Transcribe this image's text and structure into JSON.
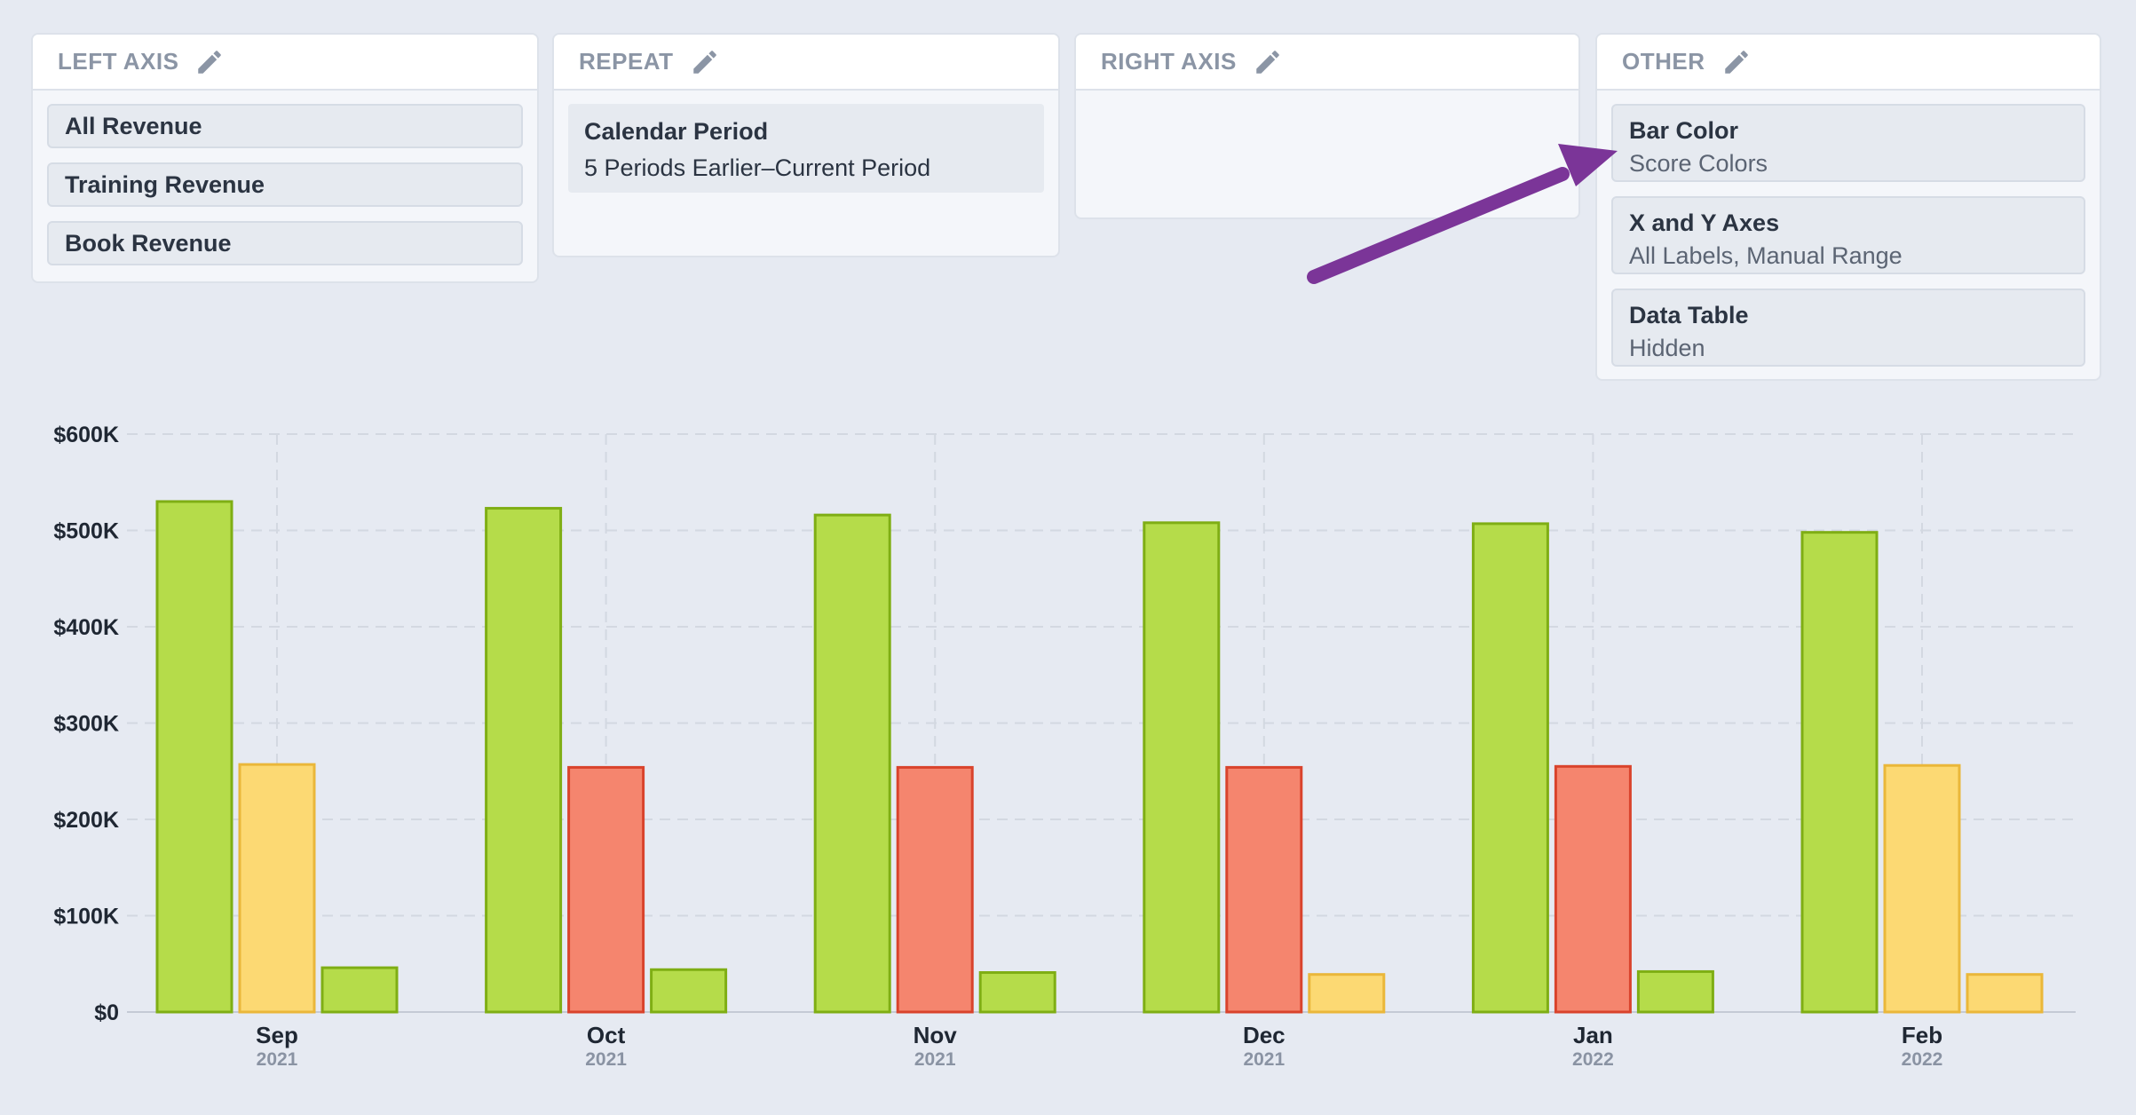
{
  "panels": {
    "left_axis": {
      "title": "LEFT AXIS",
      "items": [
        "All Revenue",
        "Training Revenue",
        "Book Revenue"
      ]
    },
    "repeat": {
      "title": "REPEAT",
      "card": {
        "title": "Calendar Period",
        "value": "5 Periods Earlier–Current Period"
      }
    },
    "right_axis": {
      "title": "RIGHT AXIS"
    },
    "other": {
      "title": "OTHER",
      "cards": [
        {
          "title": "Bar Color",
          "value": "Score Colors"
        },
        {
          "title": "X and Y Axes",
          "value": "All Labels, Manual Range"
        },
        {
          "title": "Data Table",
          "value": "Hidden"
        }
      ]
    }
  },
  "icons": {
    "edit": "pencil-icon",
    "annotation": "arrow-annotation"
  },
  "colors": {
    "green_fill": "#b5dc4a",
    "green_stroke": "#7fae14",
    "yellow_fill": "#fcd973",
    "yellow_stroke": "#eab73a",
    "red_fill": "#f5856e",
    "red_stroke": "#d9432c",
    "arrow": "#7b3598",
    "grid": "#d3d8e1"
  },
  "chart_data": {
    "type": "bar",
    "ylim": [
      0,
      600000
    ],
    "yticks": [
      "$0",
      "$100K",
      "$200K",
      "$300K",
      "$400K",
      "$500K",
      "$600K"
    ],
    "grid": true,
    "categories": [
      {
        "month": "Sep",
        "year": "2021"
      },
      {
        "month": "Oct",
        "year": "2021"
      },
      {
        "month": "Nov",
        "year": "2021"
      },
      {
        "month": "Dec",
        "year": "2021"
      },
      {
        "month": "Jan",
        "year": "2022"
      },
      {
        "month": "Feb",
        "year": "2022"
      }
    ],
    "series": [
      {
        "name": "All Revenue",
        "values": [
          530000,
          523000,
          516000,
          508000,
          507000,
          498000
        ],
        "colors": [
          "green",
          "green",
          "green",
          "green",
          "green",
          "green"
        ]
      },
      {
        "name": "Training Revenue",
        "values": [
          257000,
          254000,
          254000,
          254000,
          255000,
          256000
        ],
        "colors": [
          "yellow",
          "red",
          "red",
          "red",
          "red",
          "yellow"
        ]
      },
      {
        "name": "Book Revenue",
        "values": [
          46000,
          44000,
          41000,
          39000,
          42000,
          39000
        ],
        "colors": [
          "green",
          "green",
          "green",
          "yellow",
          "green",
          "yellow"
        ]
      }
    ]
  }
}
